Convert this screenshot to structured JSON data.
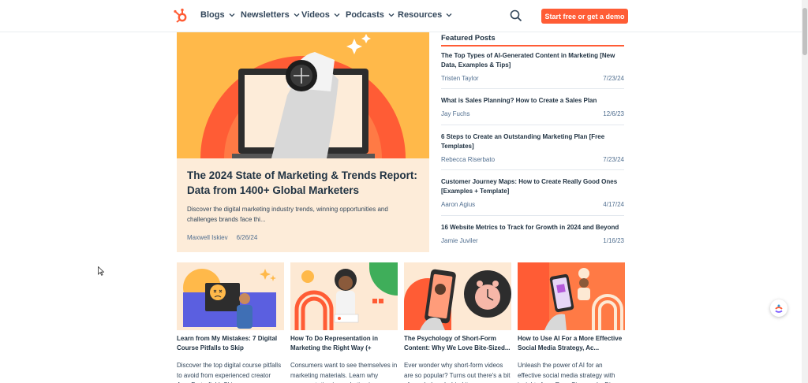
{
  "nav": {
    "items": [
      {
        "label": "Blogs"
      },
      {
        "label": "Newsletters"
      },
      {
        "label": "Videos"
      },
      {
        "label": "Podcasts"
      },
      {
        "label": "Resources"
      }
    ],
    "cta_label": "Start free or get a demo",
    "icons": {
      "logo": "hubspot-sprocket-icon",
      "search": "search-icon",
      "chevron": "chevron-down-icon"
    }
  },
  "hero": {
    "title": "The 2024 State of Marketing & Trends Report: Data from 1400+ Global Marketers",
    "description": "Discover the digital marketing industry trends, winning opportunities and challenges brands face thi...",
    "author": "Maxwell Iskiev",
    "date": "6/26/24"
  },
  "featured": {
    "heading": "Featured Posts",
    "posts": [
      {
        "title": "The Top Types of AI-Generated Content in Marketing [New Data, Examples & Tips]",
        "author": "Tristen Taylor",
        "date": "7/23/24"
      },
      {
        "title": "What is Sales Planning? How to Create a Sales Plan",
        "author": "Jay Fuchs",
        "date": "12/6/23"
      },
      {
        "title": "6 Steps to Create an Outstanding Marketing Plan [Free Templates]",
        "author": "Rebecca Riserbato",
        "date": "7/23/24"
      },
      {
        "title": "Customer Journey Maps: How to Create Really Good Ones [Examples + Template]",
        "author": "Aaron Agius",
        "date": "4/17/24"
      },
      {
        "title": "16 Website Metrics to Track for Growth in 2024 and Beyond",
        "author": "Jamie Juviler",
        "date": "1/16/23"
      }
    ]
  },
  "cards": [
    {
      "title": "Learn from My Mistakes: 7 Digital Course Pitfalls to Skip",
      "description": "Discover the top digital course pitfalls to avoid from experienced creator Amy Porterfield. Skip com..."
    },
    {
      "title": "How To Do Representation in Marketing the Right Way (+ Consu...",
      "description": "Consumers want to see themselves in marketing materials. Learn why representation in marketing is so..."
    },
    {
      "title": "The Psychology of Short-Form Content: Why We Love Bite-Sized...",
      "description": "Ever wonder why short-form videos are so popular? Turns out there's a bit of psychology behind it."
    },
    {
      "title": "How to Use AI For a More Effective Social Media Strategy, Ac...",
      "description": "Unleash the power of AI for an effective social media strategy with insights from Ross Simmonds. Dis..."
    }
  ],
  "colors": {
    "accent": "#ff5c35",
    "text": "#213343",
    "hero_bg": "#fdecd9",
    "hero_art": "#ffb94a"
  }
}
